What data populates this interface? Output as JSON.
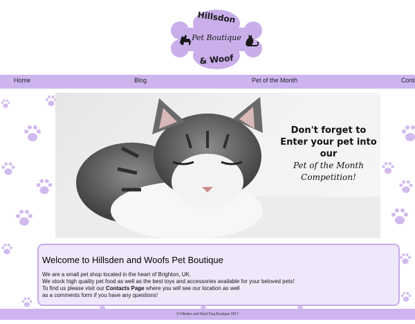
{
  "logo": {
    "top_text": "Hillsdon",
    "middle_text": "Pet Boutique",
    "bottom_text": "& Woof"
  },
  "nav": {
    "items": [
      "Home",
      "Blog",
      "Pet of the Month",
      "Conta"
    ]
  },
  "hero": {
    "caption_lines": [
      "Don't forget to",
      "Enter your pet into",
      "our"
    ],
    "caption_italic_lines": [
      "Pet of the Month",
      "Competition!"
    ]
  },
  "welcome": {
    "title": "Welcome to Hillsden and Woofs Pet Boutique",
    "line1": "We are a small pet shop located in the heart of Brighton, UK.",
    "line2": "We stock high quality pet food as well as the best toys and accessories available for your beloved pets!",
    "line3_prefix": "To find us please visit our ",
    "line3_link": "Contacts Page",
    "line3_suffix": " where you will see our location as well",
    "line4": "as a comments form if you have any questions!"
  },
  "footer": {
    "text": "© Hillsden and Woof Dog Boutique 2017"
  },
  "colors": {
    "accent": "#cdb4ee",
    "paw": "#c9aeea",
    "panel": "#efe8fa"
  }
}
